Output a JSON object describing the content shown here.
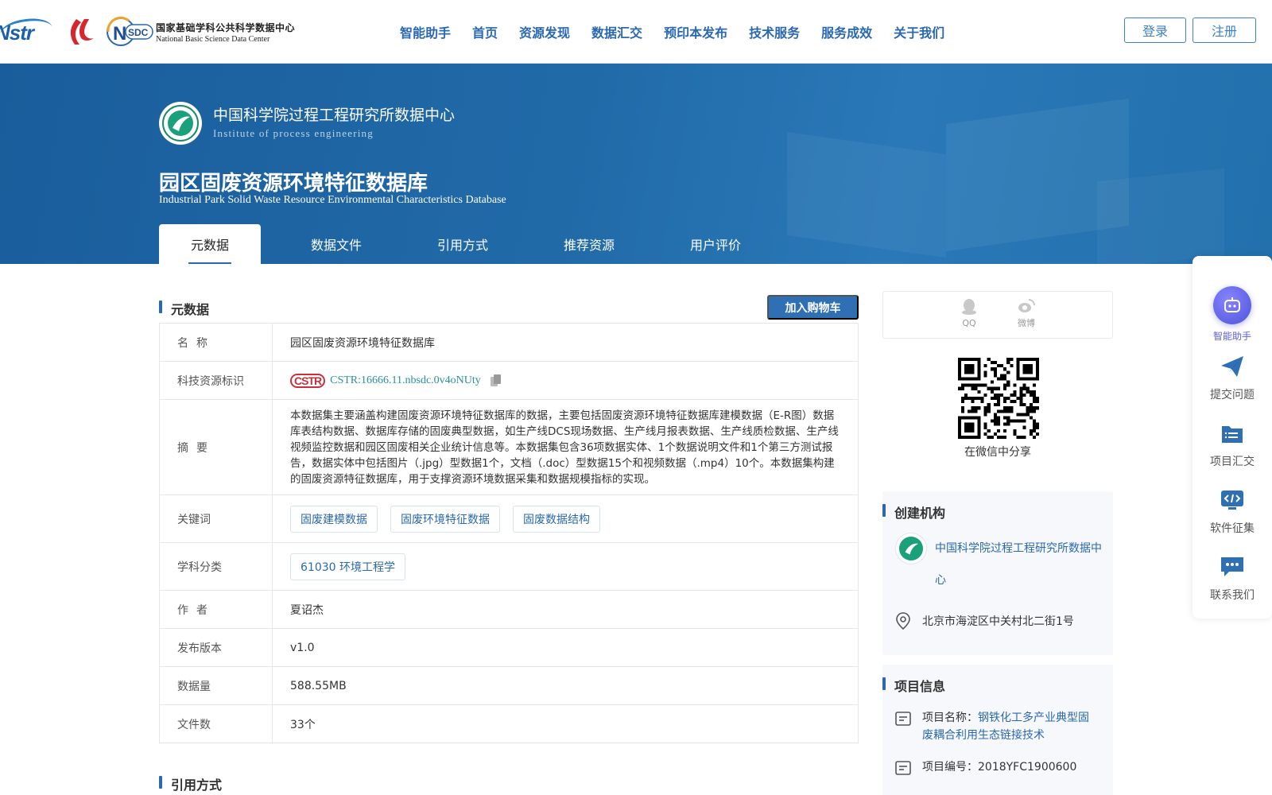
{
  "header": {
    "logos": {
      "nsdc_cn": "国家基础学科公共科学数据中心",
      "nsdc_en": "National Basic Science Data Center",
      "nsdc_mark": "SDC",
      "cstr_mark": "Nstr"
    },
    "nav": [
      "智能助手",
      "首页",
      "资源发现",
      "数据汇交",
      "预印本发布",
      "技术服务",
      "服务成效",
      "关于我们"
    ],
    "login": "登录",
    "register": "注册"
  },
  "banner": {
    "institution_name": "中国科学院过程工程研究所数据中心",
    "institution_en": "Institute of process engineering",
    "title": "园区固废资源环境特征数据库",
    "title_en": "Industrial Park Solid Waste Resource Environmental Characteristics Database",
    "tabs": [
      "元数据",
      "数据文件",
      "引用方式",
      "推荐资源",
      "用户评价"
    ],
    "active_tab": 0
  },
  "metadata": {
    "section_title": "元数据",
    "cart_button": "加入购物车",
    "rows": {
      "name": {
        "key": "名称",
        "value": "园区固废资源环境特征数据库"
      },
      "cstr": {
        "key": "科技资源标识",
        "badge": "CSTR",
        "value": "CSTR:16666.11.nbsdc.0v4oNUty"
      },
      "abstract": {
        "key": "摘要",
        "value": "本数据集主要涵盖构建固废资源环境特征数据库的数据，主要包括固废资源环境特征数据库建模数据（E-R图）数据库表结构数据、数据库存储的固废典型数据，如生产线DCS现场数据、生产线月报表数据、生产线质检数据、生产线视频监控数据和园区固废相关企业统计信息等。本数据集包含36项数据实体、1个数据说明文件和1个第三方测试报告，数据实体中包括图片（.jpg）型数据1个，文档（.doc）型数据15个和视频数据（.mp4）10个。本数据集构建的固废资源特征数据库，用于支撑资源环境数据采集和数据规模指标的实现。"
      },
      "keywords": {
        "key": "关键词",
        "values": [
          "固废建模数据",
          "固废环境特征数据",
          "固废数据结构"
        ]
      },
      "subject": {
        "key": "学科分类",
        "value": "61030 环境工程学"
      },
      "author": {
        "key": "作者",
        "value": "夏诏杰"
      },
      "version": {
        "key": "发布版本",
        "value": "v1.0"
      },
      "size": {
        "key": "数据量",
        "value": "588.55MB"
      },
      "files": {
        "key": "文件数",
        "value": "33个"
      }
    }
  },
  "citation": {
    "section_title": "引用方式"
  },
  "share": {
    "qq": "QQ",
    "weibo": "微博",
    "wechat_caption": "在微信中分享"
  },
  "creator": {
    "section_title": "创建机构",
    "institution": "中国科学院过程工程研究所数据中心",
    "address": "北京市海淀区中关村北二街1号"
  },
  "project": {
    "section_title": "项目信息",
    "name_label": "项目名称：",
    "name_value": "钢铁化工多产业典型固废耦合利用生态链接技术",
    "number_label": "项目编号：",
    "number_value": "2018YFC1900600"
  },
  "float_bar": [
    "智能助手",
    "提交问题",
    "项目汇交",
    "软件征集",
    "联系我们"
  ],
  "colors": {
    "brand_blue": "#2a68b0",
    "banner": "#1f64a3",
    "cstr_red": "#c8313b",
    "assistant_purple": "#5a5ee0"
  }
}
